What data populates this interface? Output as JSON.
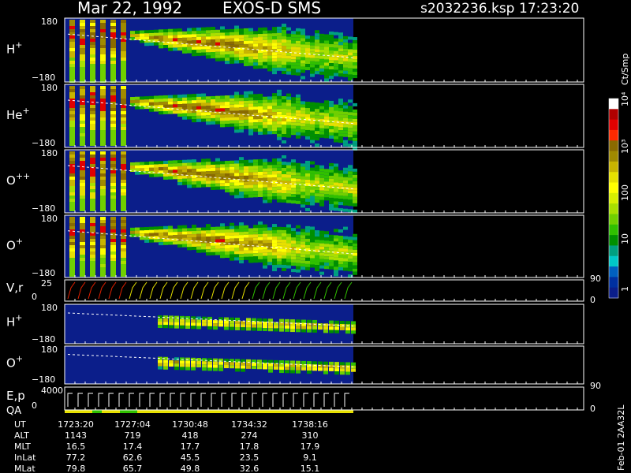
{
  "header": {
    "date": "Mar 22, 1992",
    "instrument": "EXOS-D SMS",
    "file": "s2032236.ksp",
    "time": "17:23:20"
  },
  "colors": {
    "background": "#000000",
    "panel_bg": "#0b1e8a",
    "axis": "#ffffff",
    "trace": "#ffffff"
  },
  "chart_data": {
    "type": "heatmap",
    "panels": [
      {
        "id": "h-plus",
        "label": "H",
        "sup": "+",
        "ymax": "180",
        "ymin": "−180",
        "kind": "pitch",
        "data_end_frac": 0.5
      },
      {
        "id": "he-plus",
        "label": "He",
        "sup": "+",
        "ymax": "180",
        "ymin": "−180",
        "kind": "pitch",
        "data_end_frac": 0.5
      },
      {
        "id": "o-plus-plus",
        "label": "O",
        "sup": "++",
        "ymax": "180",
        "ymin": "−180",
        "kind": "pitch",
        "data_end_frac": 0.5
      },
      {
        "id": "o-plus",
        "label": "O",
        "sup": "+",
        "ymax": "180",
        "ymin": "−180",
        "kind": "pitch",
        "data_end_frac": 0.5
      },
      {
        "id": "vr",
        "label": "V,r",
        "sup": "",
        "ymax": "25",
        "ymin": "0",
        "right_top": "90",
        "right_bottom": "0",
        "kind": "line"
      },
      {
        "id": "h-plus-2",
        "label": "H",
        "sup": "+",
        "ymax": "180",
        "ymin": "−180",
        "kind": "pitch2"
      },
      {
        "id": "o-plus-2",
        "label": "O",
        "sup": "+",
        "ymax": "180",
        "ymin": "−180",
        "kind": "pitch2"
      },
      {
        "id": "ep",
        "label": "E,p",
        "sub": "QA",
        "ymax": "4000",
        "ymin": "0",
        "right_top": "90",
        "right_bottom": "0",
        "kind": "line2"
      }
    ],
    "colorbar": {
      "unit": "Ct/Smp",
      "labels": [
        "10⁴",
        "10³",
        "100",
        "10",
        "1"
      ],
      "colors": [
        "#ffffff",
        "#b00000",
        "#e00000",
        "#ff2a00",
        "#8a6a00",
        "#a08a00",
        "#c8b400",
        "#e6e000",
        "#ffff00",
        "#d8f000",
        "#a8e000",
        "#70d000",
        "#30c000",
        "#009000",
        "#00a080",
        "#00c8c8",
        "#0060c0",
        "#0030a0",
        "#0b1e8a"
      ]
    },
    "x_axis": {
      "ticks": [
        "1723:20",
        "1727:04",
        "1730:48",
        "1734:32",
        "1738:16"
      ],
      "rows": [
        {
          "label": "UT",
          "values": [
            "1723:20",
            "1727:04",
            "1730:48",
            "1734:32",
            "1738:16"
          ]
        },
        {
          "label": "ALT",
          "values": [
            "1143",
            "719",
            "418",
            "274",
            "310"
          ]
        },
        {
          "label": "MLT",
          "values": [
            "16.5",
            "17.4",
            "17.7",
            "17.8",
            "17.9"
          ]
        },
        {
          "label": "InLat",
          "values": [
            "77.2",
            "62.6",
            "45.5",
            "23.5",
            "9.1"
          ]
        },
        {
          "label": "MLat",
          "values": [
            "79.8",
            "65.7",
            "49.8",
            "32.6",
            "15.1"
          ]
        }
      ]
    },
    "footer_id": "Feb-01 2AA32L"
  }
}
